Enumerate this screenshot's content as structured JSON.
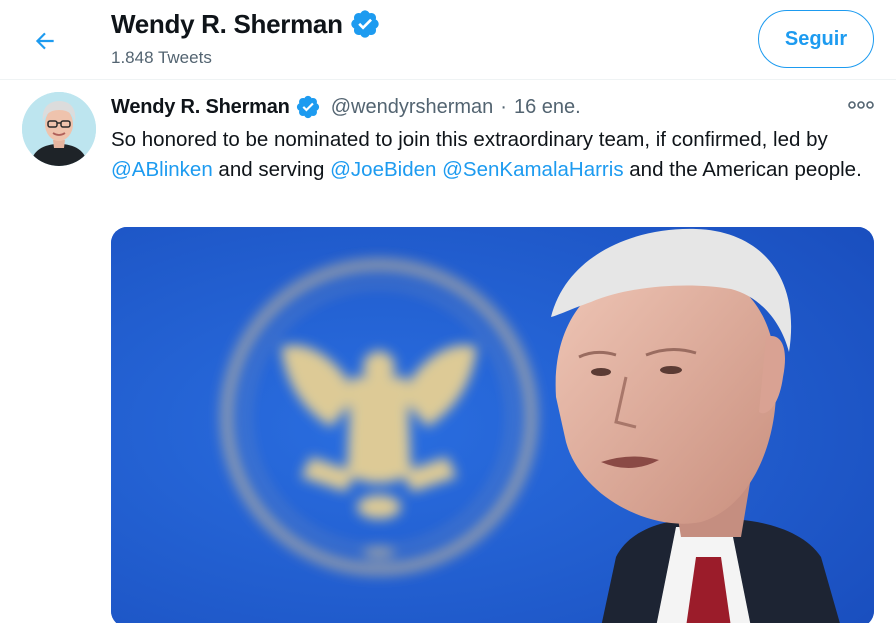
{
  "header": {
    "back_icon": "arrow-left-icon",
    "title": "Wendy R. Sherman",
    "verified_icon": "verified-badge-icon",
    "tweet_count": "1.848 Tweets",
    "follow_label": "Seguir"
  },
  "tweet": {
    "author_name": "Wendy R. Sherman",
    "handle": "@wendyrsherman",
    "separator": "·",
    "date": "16 ene.",
    "more_icon": "more-options-icon",
    "text_1": "So honored to be nominated to join this extraordinary team, if confirmed, led by ",
    "mention_1": "@ABlinken",
    "text_2": " and serving ",
    "mention_2": "@JoeBiden",
    "text_3": " ",
    "mention_3": "@SenKamalaHarris",
    "text_4": " and the American people."
  },
  "colors": {
    "accent": "#1d9bf0",
    "text": "#0f1419",
    "secondary": "#536471",
    "photo_background": "#1f58c8"
  }
}
